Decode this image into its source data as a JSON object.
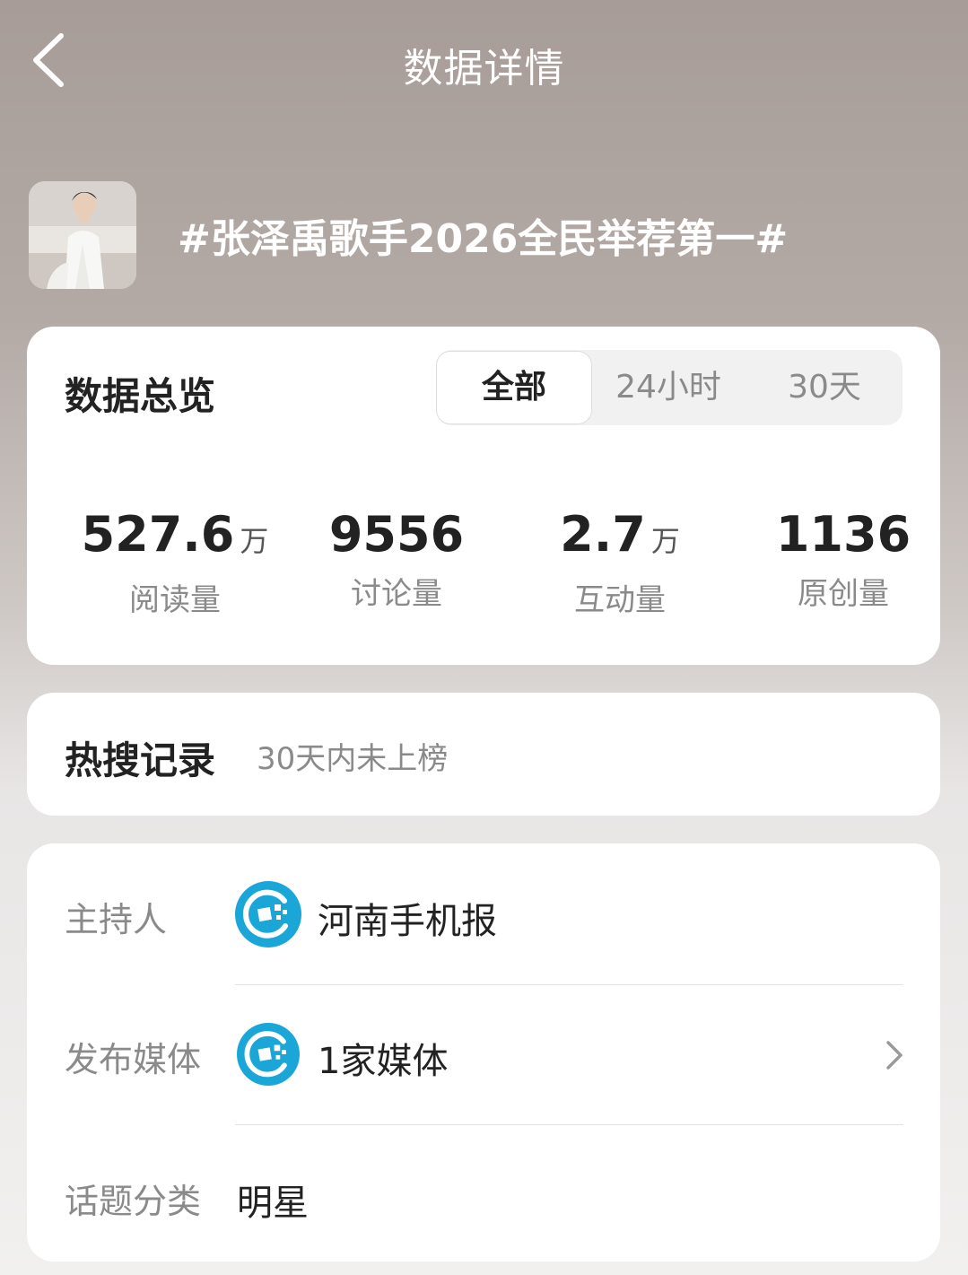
{
  "header": {
    "title": "数据详情"
  },
  "topic": {
    "title": "#张泽禹歌手2026全民举荐第一#"
  },
  "overview": {
    "title": "数据总览",
    "tabs": [
      "全部",
      "24小时",
      "30天"
    ],
    "active_tab": "全部",
    "stats": [
      {
        "value": "527.6",
        "unit": "万",
        "label": "阅读量"
      },
      {
        "value": "9556",
        "unit": "",
        "label": "讨论量"
      },
      {
        "value": "2.7",
        "unit": "万",
        "label": "互动量"
      },
      {
        "value": "1136",
        "unit": "",
        "label": "原创量"
      }
    ]
  },
  "hot_search": {
    "title": "热搜记录",
    "subtitle": "30天内未上榜"
  },
  "info": {
    "host_label": "主持人",
    "host_value": "河南手机报",
    "media_label": "发布媒体",
    "media_value": "1家媒体",
    "category_label": "话题分类",
    "category_value": "明星"
  },
  "colors": {
    "org_icon": "#1aa7d8",
    "title_on_header": "#ffffff"
  }
}
